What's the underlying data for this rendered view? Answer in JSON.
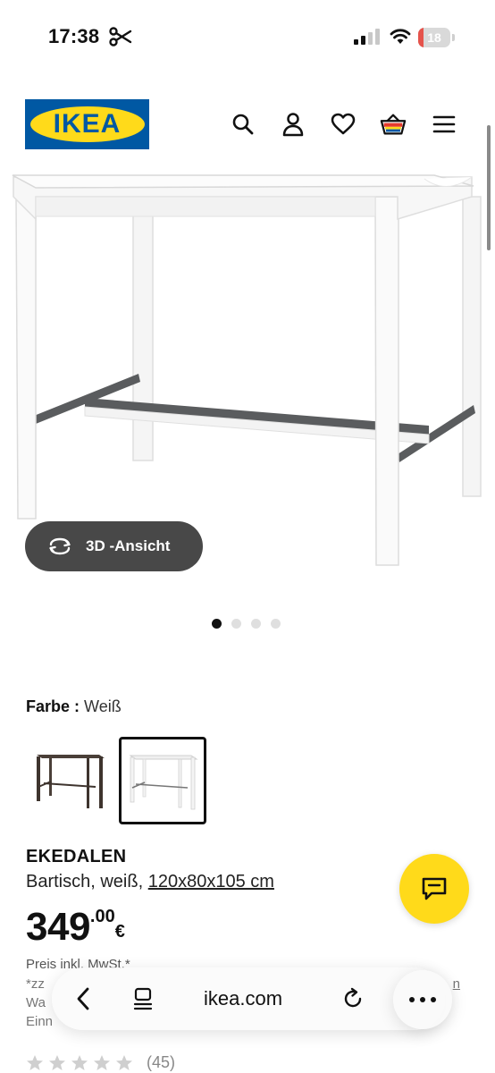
{
  "status_bar": {
    "time": "17:38",
    "battery": "18",
    "battery_level": 0.18
  },
  "header": {
    "logo_text": "IKEA",
    "icons": [
      "search-icon",
      "user-icon",
      "heart-icon",
      "basket-icon",
      "menu-icon"
    ]
  },
  "gallery": {
    "view_3d_label": "3D -Ansicht",
    "slides": 4,
    "active_slide": 1
  },
  "product": {
    "color_label": "Farbe :",
    "color_value": "Weiß",
    "swatches": [
      "dark brown",
      "white"
    ],
    "selected_swatch": "white",
    "name": "EKEDALEN",
    "description": "Bartisch, weiß,",
    "size": "120x80x105 cm",
    "price_integer": "349",
    "price_decimal": ".00",
    "price_currency": "€",
    "tax_note": "Preis inkl. MwSt.*",
    "fine_print_start": "*zz",
    "fine_print_link": "n",
    "fine_print_line2": "Wa",
    "fine_print_line3": "Einn",
    "rating_count": "(45)"
  },
  "browser": {
    "url": "ikea.com"
  },
  "colors": {
    "ikea_blue": "#0058a3",
    "ikea_yellow": "#ffda1a",
    "button_dark": "#484848"
  }
}
